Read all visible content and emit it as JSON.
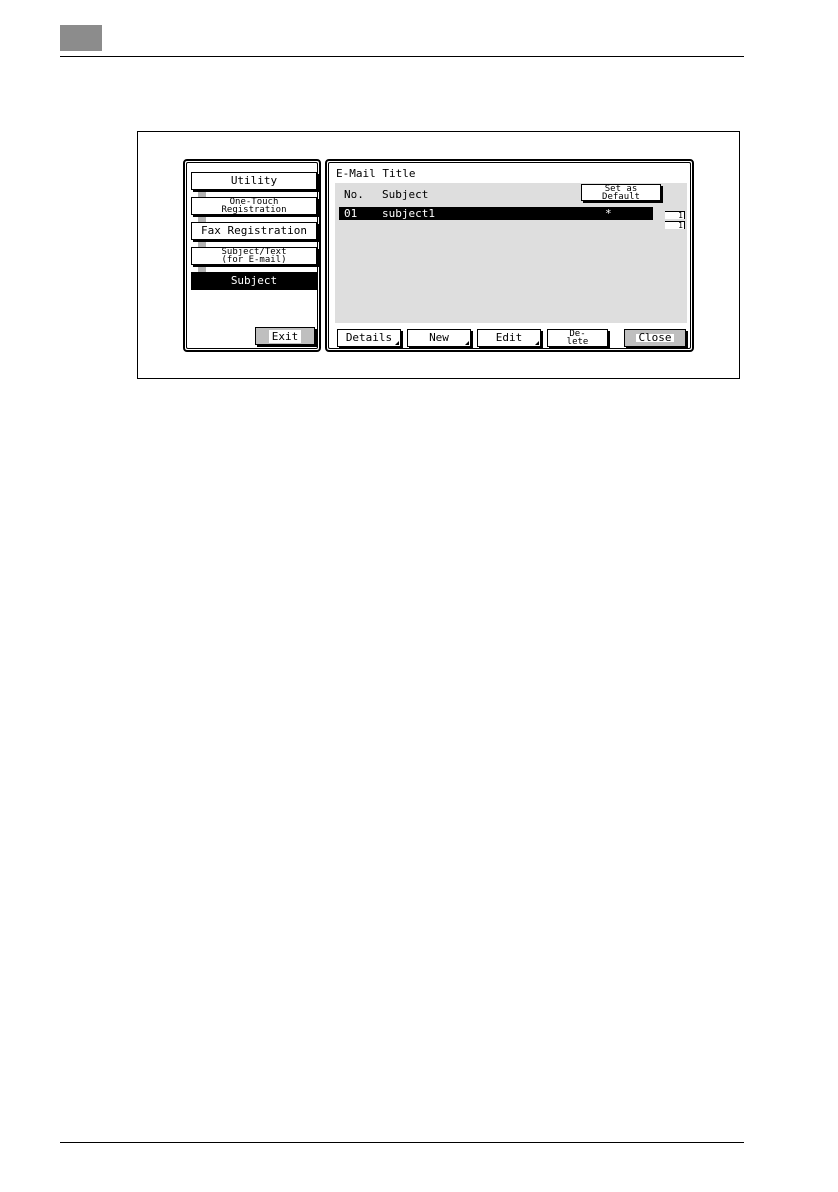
{
  "left_nav": {
    "items": [
      {
        "label": "Utility"
      },
      {
        "label": "One-Touch\nRegistration"
      },
      {
        "label": "Fax Registration"
      },
      {
        "label": "Subject/Text\n(for E-mail)"
      },
      {
        "label": "Subject"
      }
    ],
    "exit_label": "Exit"
  },
  "main": {
    "title": "E-Mail Title",
    "columns": {
      "no": "No.",
      "subject": "Subject"
    },
    "set_default_label": "Set as\nDefault",
    "rows": [
      {
        "no": "01",
        "subject": "subject1",
        "default_mark": "*"
      }
    ],
    "page_indicator": {
      "current": "1",
      "total": "1"
    },
    "buttons": {
      "details": "Details",
      "new": "New",
      "edit": "Edit",
      "delete": "De-\nlete",
      "close": "Close"
    }
  }
}
